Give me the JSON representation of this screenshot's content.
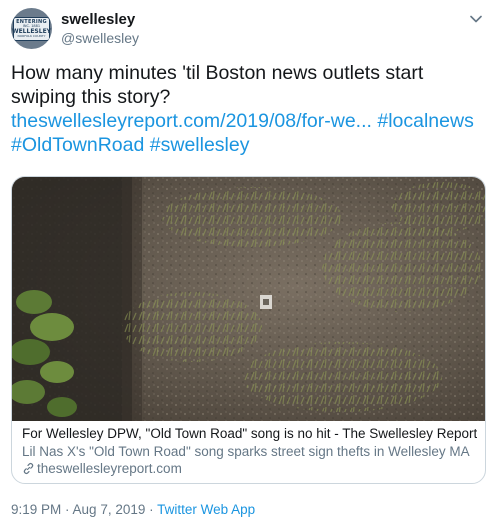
{
  "user": {
    "display_name": "swellesley",
    "handle": "@swellesley",
    "avatar_sign": {
      "line1": "ENTERING",
      "line2": "INC. 1881",
      "line3": "WELLESLEY",
      "line4": "NORFOLK COUNTY"
    }
  },
  "tweet": {
    "text": "How many minutes 'til Boston news outlets start swiping this story?",
    "link": "theswellesleyreport.com/2019/08/for-we...",
    "hashtags": [
      "#localnews",
      "#OldTownRoad",
      "#swellesley"
    ]
  },
  "card": {
    "title": "For Wellesley DPW, \"Old Town Road\" song is no hit - The Swellesley Report",
    "description": "Lil Nas X's \"Old Town Road\" song sparks street sign thefts in Wellesley MA",
    "domain": "theswellesleyreport.com",
    "image_icon": "photo-of-dirt-and-grass"
  },
  "meta": {
    "time": "9:19 PM",
    "separator": " · ",
    "date": "Aug 7, 2019",
    "app": "Twitter Web App"
  },
  "colors": {
    "link": "#1b95e0",
    "secondary": "#657786",
    "text": "#14171a",
    "border": "#ccd6dd"
  },
  "icons": {
    "more": "chevron-down-icon",
    "domain": "link-icon"
  }
}
